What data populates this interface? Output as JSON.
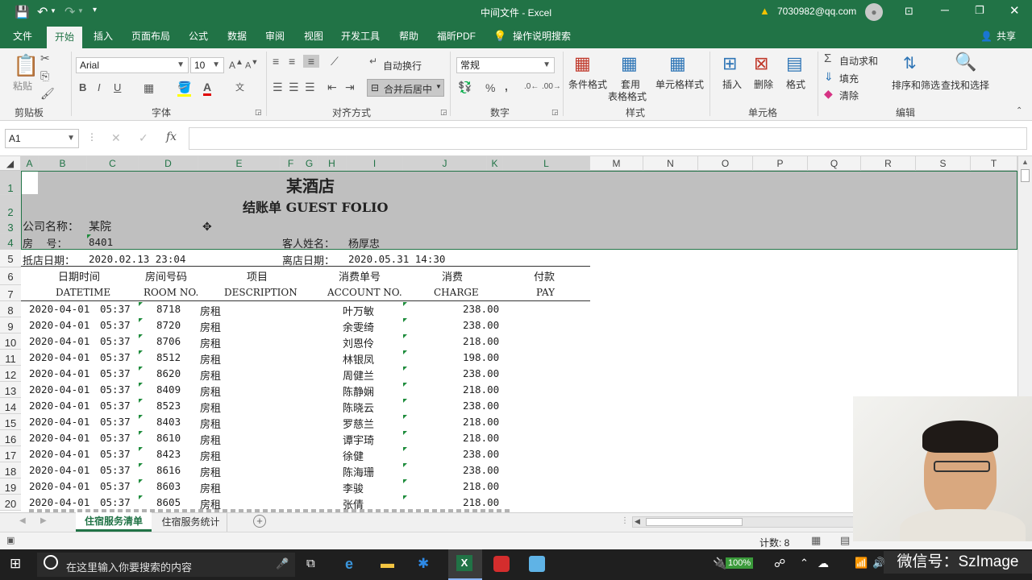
{
  "title_bar": {
    "doc_title": "中间文件",
    "app_name": "Excel",
    "separator": " - ",
    "account": "7030982@qq.com"
  },
  "tabs": [
    "文件",
    "开始",
    "插入",
    "页面布局",
    "公式",
    "数据",
    "审阅",
    "视图",
    "开发工具",
    "帮助",
    "福昕PDF",
    "操作说明搜索"
  ],
  "share_label": "共享",
  "ribbon": {
    "clipboard": {
      "paste": "粘贴",
      "group": "剪贴板"
    },
    "font": {
      "name": "Arial",
      "size": "10",
      "bold": "B",
      "italic": "I",
      "underline": "U",
      "group": "字体"
    },
    "alignment": {
      "wrap": "自动换行",
      "merge": "合并后居中",
      "group": "对齐方式"
    },
    "number": {
      "format": "常规",
      "percent": "%",
      "comma": ",",
      "group": "数字"
    },
    "styles": {
      "conditional": "条件格式",
      "table_line1": "套用",
      "table_line2": "表格格式",
      "cell_styles": "单元格样式",
      "group": "样式"
    },
    "cells": {
      "insert": "插入",
      "delete": "删除",
      "format": "格式",
      "group": "单元格"
    },
    "editing": {
      "autosum": "自动求和",
      "fill": "填充",
      "clear": "清除",
      "sort": "排序和筛选",
      "find": "查找和选择",
      "group": "编辑"
    }
  },
  "formula_bar": {
    "name_box": "A1",
    "fx": "fx",
    "value": ""
  },
  "columns": [
    "A",
    "B",
    "C",
    "D",
    "E",
    "F",
    "G",
    "H",
    "I",
    "J",
    "K",
    "L",
    "M",
    "N",
    "O",
    "P",
    "Q",
    "R",
    "S",
    "T"
  ],
  "rows": [
    "1",
    "2",
    "3",
    "4",
    "5",
    "6",
    "7",
    "8",
    "9",
    "10",
    "11",
    "12",
    "13",
    "14",
    "15",
    "16",
    "17",
    "18",
    "19",
    "20"
  ],
  "sheet": {
    "hotel": "某酒店",
    "folio_title": "结账单 GUEST FOLIO",
    "company_label": "公司名称：",
    "company_value": "某院",
    "room_label": "房    号：",
    "room_value": "8401",
    "guest_label": "客人姓名：",
    "guest_value": "杨厚忠",
    "arrive_label": "抵店日期：",
    "arrive_value": "2020.02.13 23:04",
    "depart_label": "离店日期：",
    "depart_value": "2020.05.31 14:30",
    "headers_cn": [
      "日期时间",
      "房间号码",
      "项目",
      "消费单号",
      "消费",
      "付款"
    ],
    "headers_en": [
      "DATETIME",
      "ROOM NO.",
      "DESCRIPTION",
      "ACCOUNT NO.",
      "CHARGE",
      "PAY"
    ],
    "records": [
      {
        "date": "2020-04-01",
        "time": "05:37",
        "room": "8718",
        "item": "房租",
        "name": "叶万敏",
        "charge": "238.00"
      },
      {
        "date": "2020-04-01",
        "time": "05:37",
        "room": "8720",
        "item": "房租",
        "name": "余雯绮",
        "charge": "238.00"
      },
      {
        "date": "2020-04-01",
        "time": "05:37",
        "room": "8706",
        "item": "房租",
        "name": "刘恩伶",
        "charge": "218.00"
      },
      {
        "date": "2020-04-01",
        "time": "05:37",
        "room": "8512",
        "item": "房租",
        "name": "林银凤",
        "charge": "198.00"
      },
      {
        "date": "2020-04-01",
        "time": "05:37",
        "room": "8620",
        "item": "房租",
        "name": "周健兰",
        "charge": "238.00"
      },
      {
        "date": "2020-04-01",
        "time": "05:37",
        "room": "8409",
        "item": "房租",
        "name": "陈静娴",
        "charge": "218.00"
      },
      {
        "date": "2020-04-01",
        "time": "05:37",
        "room": "8523",
        "item": "房租",
        "name": "陈晓云",
        "charge": "238.00"
      },
      {
        "date": "2020-04-01",
        "time": "05:37",
        "room": "8403",
        "item": "房租",
        "name": "罗慈兰",
        "charge": "218.00"
      },
      {
        "date": "2020-04-01",
        "time": "05:37",
        "room": "8610",
        "item": "房租",
        "name": "谭宇琦",
        "charge": "218.00"
      },
      {
        "date": "2020-04-01",
        "time": "05:37",
        "room": "8423",
        "item": "房租",
        "name": "徐健",
        "charge": "238.00"
      },
      {
        "date": "2020-04-01",
        "time": "05:37",
        "room": "8616",
        "item": "房租",
        "name": "陈海珊",
        "charge": "238.00"
      },
      {
        "date": "2020-04-01",
        "time": "05:37",
        "room": "8603",
        "item": "房租",
        "name": "李骏",
        "charge": "218.00"
      },
      {
        "date": "2020-04-01",
        "time": "05:37",
        "room": "8605",
        "item": "房租",
        "name": "张倩",
        "charge": "218.00"
      }
    ]
  },
  "sheet_tabs": [
    "住宿服务清单",
    "住宿服务统计"
  ],
  "status": {
    "count": "计数: 8"
  },
  "taskbar": {
    "search_placeholder": "在这里输入你要搜索的内容",
    "battery": "100%"
  },
  "watermark": "微信号：SzImage",
  "colors": {
    "excel_green": "#217346",
    "selection_gray": "#bfbfbf"
  }
}
